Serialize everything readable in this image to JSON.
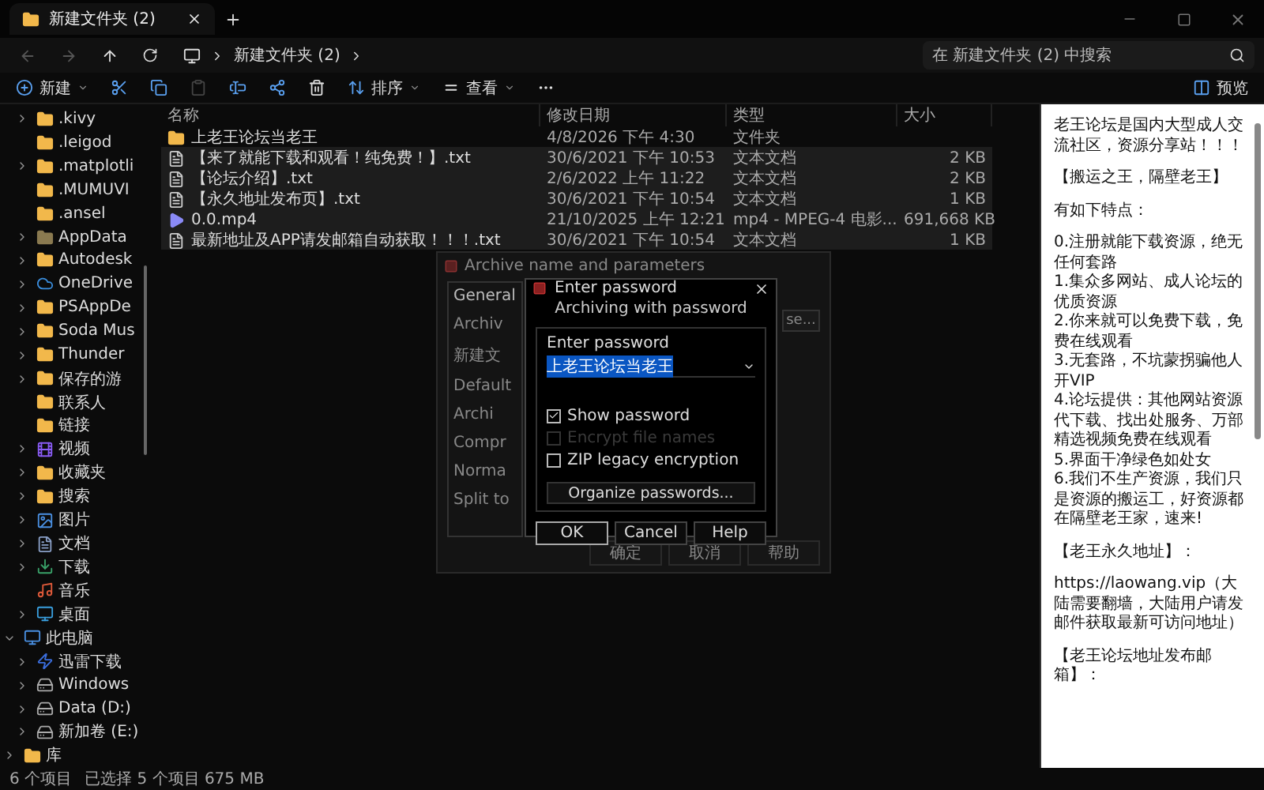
{
  "window": {
    "tab_title": "新建文件夹 (2)"
  },
  "nav": {
    "breadcrumb": [
      "新建文件夹 (2)"
    ],
    "search": {
      "placeholder": "在 新建文件夹 (2) 中搜索"
    }
  },
  "toolbar": {
    "items": [
      {
        "kind": "new",
        "label": "新建",
        "disabled": false
      },
      {
        "kind": "cut",
        "disabled": false
      },
      {
        "kind": "copy",
        "disabled": false
      },
      {
        "kind": "paste",
        "disabled": true
      },
      {
        "kind": "rename",
        "disabled": false
      },
      {
        "kind": "share",
        "disabled": false
      },
      {
        "kind": "delete",
        "disabled": false
      },
      {
        "kind": "sort",
        "label": "排序",
        "disabled": false
      },
      {
        "kind": "view",
        "label": "查看",
        "disabled": false
      },
      {
        "kind": "more",
        "disabled": false
      }
    ],
    "preview_label": "预览"
  },
  "sidebar": {
    "items": [
      {
        "label": ".kivy",
        "kind": "folder",
        "expandable": true
      },
      {
        "label": ".leigod",
        "kind": "folder",
        "expandable": false
      },
      {
        "label": ".matplotli",
        "kind": "folder",
        "expandable": true
      },
      {
        "label": ".MUMUVI",
        "kind": "folder",
        "expandable": false
      },
      {
        "label": ".ansel",
        "kind": "folder",
        "expandable": false
      },
      {
        "label": "AppData",
        "kind": "hidden-folder",
        "expandable": true
      },
      {
        "label": "Autodesk",
        "kind": "folder",
        "expandable": true
      },
      {
        "label": "OneDrive",
        "kind": "cloud",
        "expandable": true
      },
      {
        "label": "PSAppDe",
        "kind": "folder",
        "expandable": true
      },
      {
        "label": "Soda Mus",
        "kind": "folder",
        "expandable": true
      },
      {
        "label": "Thunder",
        "kind": "folder",
        "expandable": true
      },
      {
        "label": "保存的游",
        "kind": "folder",
        "expandable": true
      },
      {
        "label": "联系人",
        "kind": "folder",
        "expandable": false
      },
      {
        "label": "链接",
        "kind": "folder",
        "expandable": false
      },
      {
        "label": "视频",
        "kind": "video",
        "expandable": true
      },
      {
        "label": "收藏夹",
        "kind": "folder",
        "expandable": true
      },
      {
        "label": "搜索",
        "kind": "folder",
        "expandable": true
      },
      {
        "label": "图片",
        "kind": "picture",
        "expandable": true
      },
      {
        "label": "文档",
        "kind": "document",
        "expandable": true
      },
      {
        "label": "下载",
        "kind": "download",
        "expandable": true
      },
      {
        "label": "音乐",
        "kind": "music",
        "expandable": false
      },
      {
        "label": "桌面",
        "kind": "desktop",
        "expandable": true
      },
      {
        "label": "此电脑",
        "kind": "pc",
        "expandable": true,
        "expanded": true,
        "children": [
          {
            "label": "迅雷下载",
            "kind": "app",
            "expandable": true
          },
          {
            "label": "Windows",
            "kind": "drive",
            "expandable": true
          },
          {
            "label": "Data (D:)",
            "kind": "drive",
            "expandable": true
          },
          {
            "label": "新加卷 (E:)",
            "kind": "drive",
            "expandable": true
          }
        ]
      },
      {
        "label": "库",
        "kind": "folder",
        "expandable": true,
        "expanded": false
      }
    ]
  },
  "files": {
    "columns": [
      "名称",
      "修改日期",
      "类型",
      "大小"
    ],
    "rows": [
      {
        "kind": "folder",
        "name": "上老王论坛当老王",
        "date": "4/8/2026 下午 4:30",
        "type": "文件夹",
        "selected": false
      },
      {
        "kind": "text",
        "name": "【来了就能下载和观看！纯免费！】.txt",
        "date": "30/6/2021 下午 10:53",
        "type": "文本文档",
        "size": "2 KB",
        "selected": true
      },
      {
        "kind": "text",
        "name": "【论坛介绍】.txt",
        "date": "2/6/2022 上午 11:22",
        "type": "文本文档",
        "size": "2 KB",
        "selected": true
      },
      {
        "kind": "text",
        "name": "【永久地址发布页】.txt",
        "date": "30/6/2021 下午 10:54",
        "type": "文本文档",
        "size": "1 KB",
        "selected": true
      },
      {
        "kind": "video",
        "name": "0.0.mp4",
        "date": "21/10/2025 上午 12:21",
        "type": "mp4 - MPEG-4 电影...",
        "size": "691,668 KB",
        "selected": true
      },
      {
        "kind": "text",
        "name": "最新地址及APP请发邮箱自动获取！！！.txt",
        "date": "30/6/2021 下午 10:54",
        "type": "文本文档",
        "size": "1 KB",
        "selected": true
      }
    ]
  },
  "archive_dialog": {
    "title": "Archive name and parameters",
    "tab": {
      "label": "General",
      "selected": true
    },
    "labels": [
      "Archiv",
      "新建文",
      "Default",
      "Archi",
      "Compr",
      "Norma",
      "Split to"
    ],
    "browse_button": "se...",
    "buttons": [
      "确定",
      "取消",
      "帮助"
    ]
  },
  "password_dialog": {
    "title": "Enter password",
    "heading": "Archiving with password",
    "field_label": "Enter password",
    "value": "上老王论坛当老王",
    "checkboxes": [
      {
        "label": "Show password",
        "checked": true,
        "disabled": false
      },
      {
        "label": "Encrypt file names",
        "checked": false,
        "disabled": true
      },
      {
        "label": "ZIP legacy encryption",
        "checked": false,
        "disabled": false
      }
    ],
    "organize_button": "Organize passwords...",
    "buttons": [
      "OK",
      "Cancel",
      "Help"
    ]
  },
  "preview": {
    "blocks": [
      [
        "老王论坛是国内大型成人交流社区，资源分享站！！！"
      ],
      [
        "【搬运之王，隔壁老王】"
      ],
      [
        "有如下特点："
      ],
      [
        "0.注册就能下载资源，绝无任何套路",
        "1.集众多网站、成人论坛的优质资源",
        "2.你来就可以免费下载，免费在线观看",
        "3.无套路，不坑蒙拐骗他人开VIP",
        "4.论坛提供：其他网站资源代下载、找出处服务、万部精选视频免费在线观看",
        "5.界面干净绿色如处女",
        "6.我们不生产资源，我们只是资源的搬运工，好资源都在隔壁老王家，速来!"
      ],
      [
        "【老王永久地址】："
      ],
      [
        "https://laowang.vip（大陆需要翻墙，大陆用户请发邮件获取最新可访问地址）"
      ],
      [
        "【老王论坛地址发布邮箱】："
      ]
    ]
  },
  "status_bar": {
    "item_count": "6 个项目",
    "selection": "已选择 5 个项目  675 MB"
  }
}
